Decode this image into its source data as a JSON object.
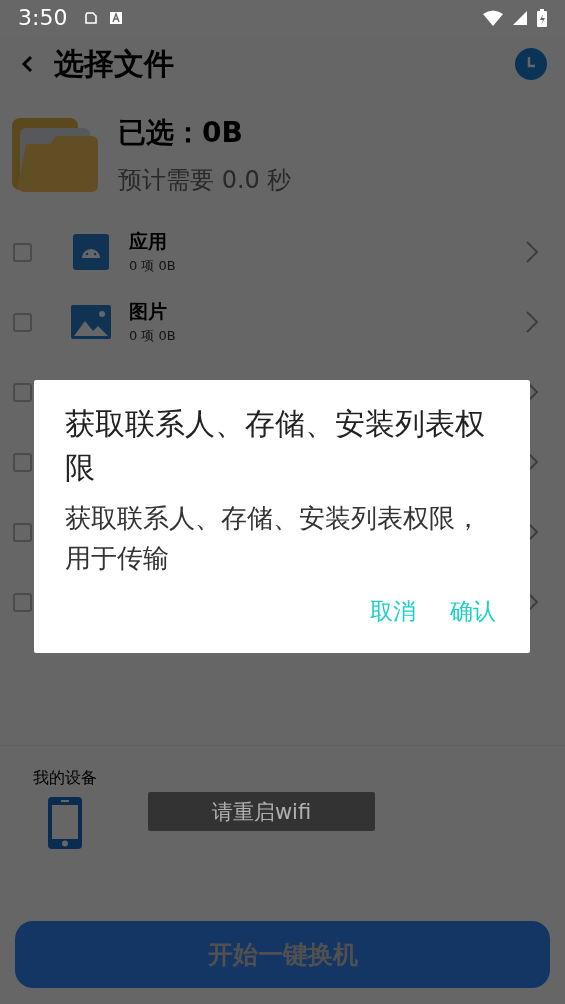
{
  "status_bar": {
    "time": "3:50"
  },
  "header": {
    "title": "选择文件"
  },
  "summary": {
    "selected": "已选：0B",
    "estimate": "预计需要 0.0 秒"
  },
  "categories": [
    {
      "title": "应用",
      "subtitle": "0 项 0B",
      "kind": "android",
      "checked": false
    },
    {
      "title": "图片",
      "subtitle": "0 项 0B",
      "kind": "image",
      "checked": false
    },
    {
      "checked": false
    },
    {
      "checked": false
    },
    {
      "checked": false
    },
    {
      "checked": false
    }
  ],
  "device": {
    "label": "我的设备"
  },
  "toast": "请重启wifi",
  "start_button": {
    "label": "开始一键换机",
    "disabled": true
  },
  "dialog": {
    "title": "获取联系人、存储、安装列表权限",
    "message": "获取联系人、存储、安装列表权限，用于传输",
    "buttons": [
      "取消",
      "确认"
    ]
  }
}
